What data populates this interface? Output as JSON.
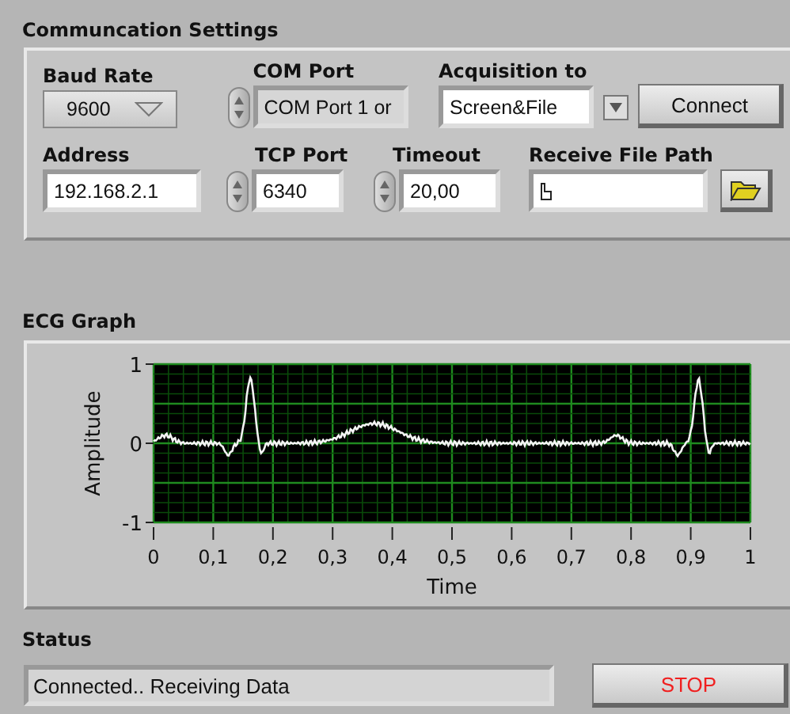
{
  "settings": {
    "title": "Communcation Settings",
    "baud_rate": {
      "label": "Baud Rate",
      "value": "9600"
    },
    "com_port": {
      "label": "COM Port",
      "value": "COM Port 1 or"
    },
    "acquisition": {
      "label": "Acquisition to",
      "value": "Screen&File"
    },
    "connect_button": "Connect",
    "address": {
      "label": "Address",
      "value": "192.168.2.1"
    },
    "tcp_port": {
      "label": "TCP Port",
      "value": "6340"
    },
    "timeout": {
      "label": "Timeout",
      "value": "20,00"
    },
    "receive_file_path": {
      "label": "Receive File Path"
    }
  },
  "graph": {
    "title": "ECG Graph",
    "ylabel": "Amplitude",
    "xlabel": "Time",
    "yticks": [
      "1",
      "0",
      "-1"
    ],
    "xticks": [
      "0",
      "0,1",
      "0,2",
      "0,3",
      "0,4",
      "0,5",
      "0,6",
      "0,7",
      "0,8",
      "0,9",
      "1"
    ]
  },
  "status": {
    "label": "Status",
    "value": "Connected.. Receiving Data"
  },
  "stop_button": "STOP"
}
